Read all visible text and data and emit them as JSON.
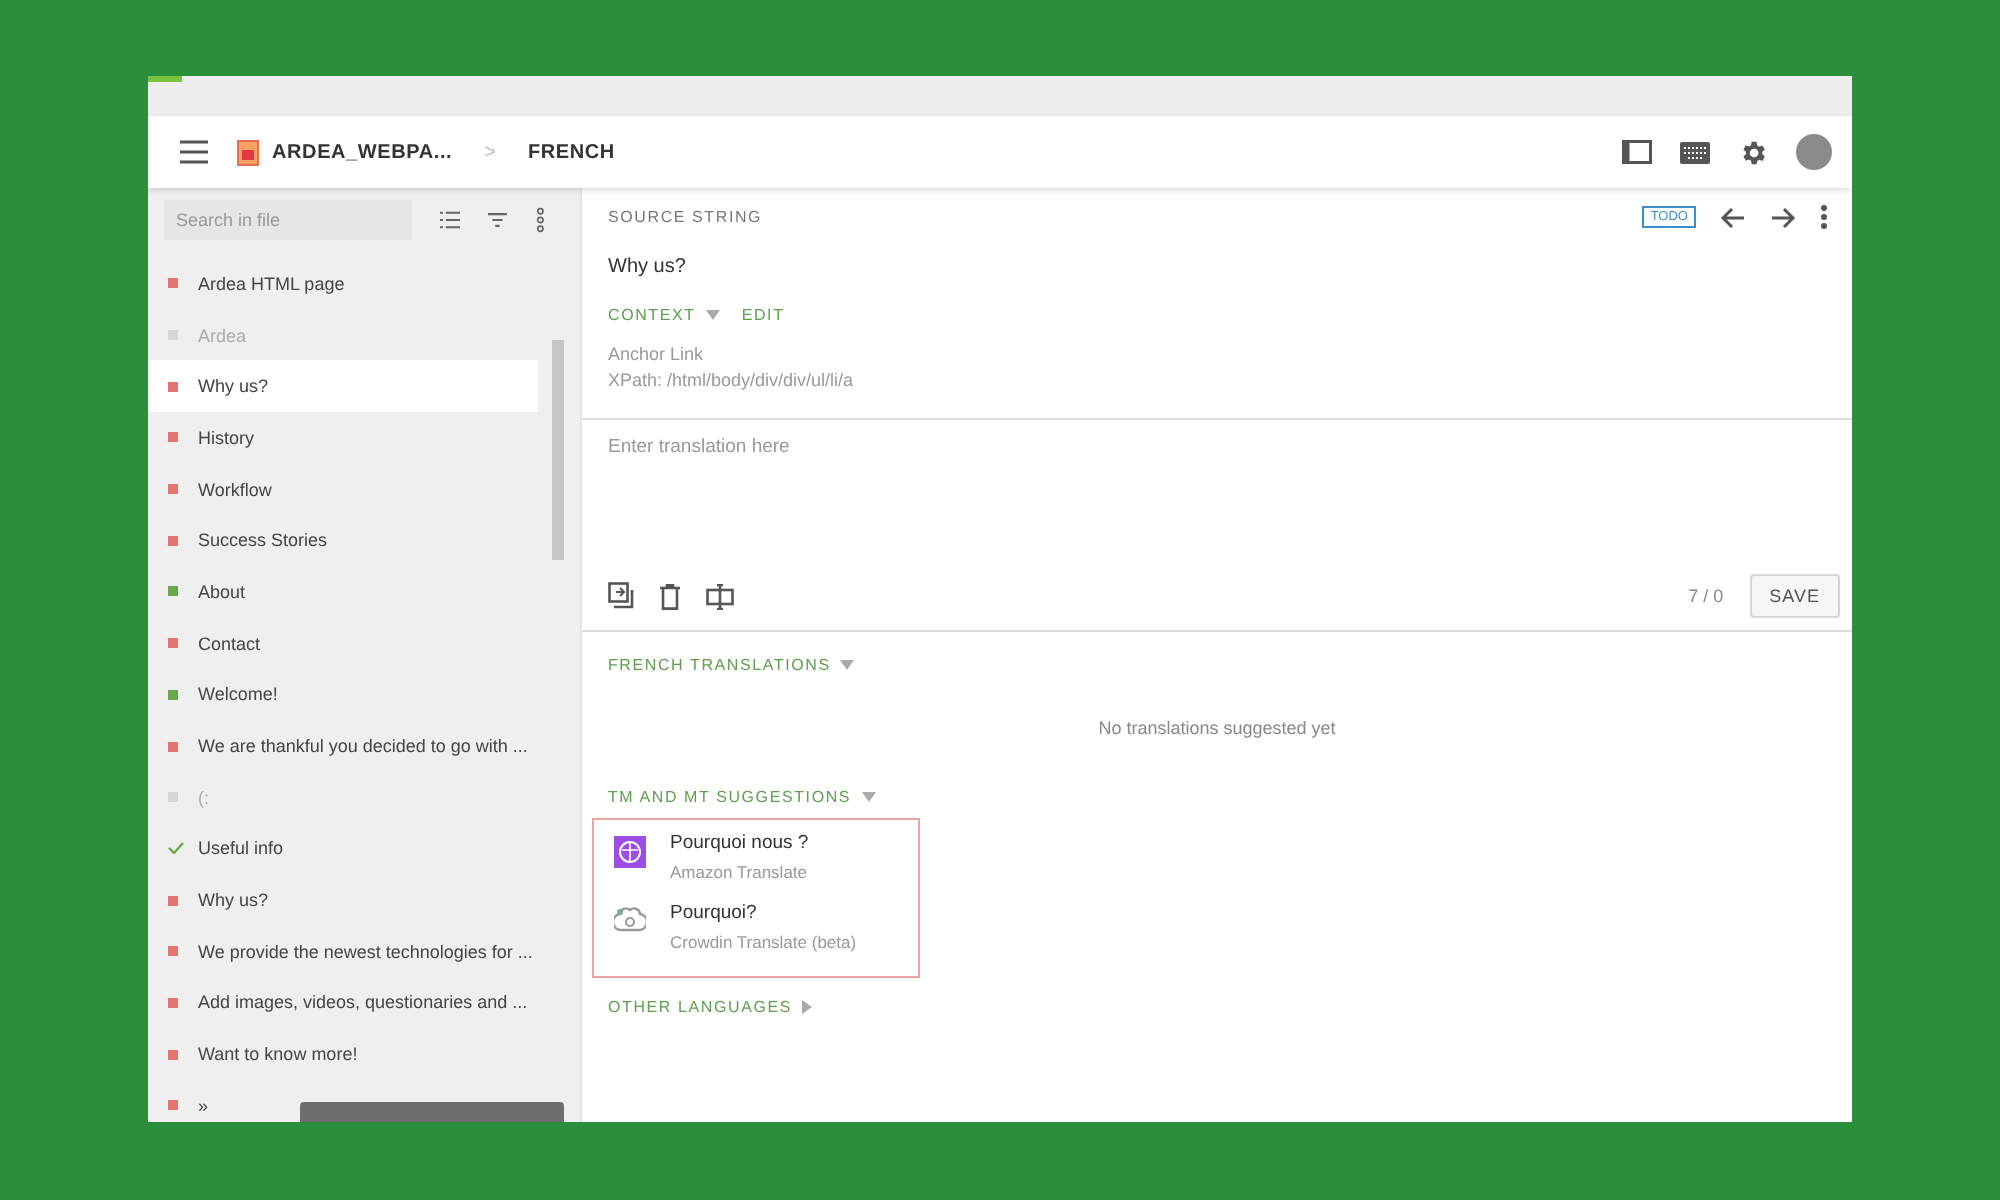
{
  "progress": {
    "level": 0.02
  },
  "header": {
    "file": "ARDEA_WEBPA...",
    "separator": ">",
    "language": "FRENCH"
  },
  "sidebar": {
    "search": {
      "placeholder": "Search in file"
    },
    "items": [
      {
        "label": "Ardea HTML page",
        "kind": "untranslated",
        "selected": false
      },
      {
        "label": "Ardea",
        "kind": "hidden",
        "selected": false
      },
      {
        "label": "Why us?",
        "kind": "untranslated",
        "selected": true
      },
      {
        "label": "History",
        "kind": "untranslated",
        "selected": false
      },
      {
        "label": "Workflow",
        "kind": "untranslated",
        "selected": false
      },
      {
        "label": "Success Stories",
        "kind": "untranslated",
        "selected": false
      },
      {
        "label": "About",
        "kind": "translated",
        "selected": false
      },
      {
        "label": "Contact",
        "kind": "untranslated",
        "selected": false
      },
      {
        "label": "Welcome!",
        "kind": "translated",
        "selected": false
      },
      {
        "label": "We are thankful you decided to go with ...",
        "kind": "untranslated",
        "selected": false
      },
      {
        "label": "(:",
        "kind": "hidden",
        "selected": false
      },
      {
        "label": "Useful info",
        "kind": "approved",
        "selected": false
      },
      {
        "label": "Why us?",
        "kind": "untranslated",
        "selected": false
      },
      {
        "label": "We provide the newest technologies for ...",
        "kind": "untranslated",
        "selected": false
      },
      {
        "label": "Add images, videos, questionaries and ...",
        "kind": "untranslated",
        "selected": false
      },
      {
        "label": "Want to know more!",
        "kind": "untranslated",
        "selected": false
      },
      {
        "label": "»",
        "kind": "untranslated",
        "selected": false
      }
    ]
  },
  "source": {
    "heading": "SOURCE STRING",
    "badge": "TODO",
    "text": "Why us?",
    "context_label": "CONTEXT",
    "edit_label": "EDIT",
    "context_lines": [
      "Anchor Link",
      "XPath: /html/body/div/div/ul/li/a"
    ]
  },
  "editor": {
    "placeholder": "Enter translation here",
    "counter": "7 / 0",
    "save": "SAVE"
  },
  "translations": {
    "heading": "FRENCH TRANSLATIONS",
    "empty": "No translations suggested yet"
  },
  "suggestions": {
    "heading": "TM AND MT SUGGESTIONS",
    "items": [
      {
        "text": "Pourquoi nous ?",
        "source": "Amazon Translate",
        "kind": "amazon"
      },
      {
        "text": "Pourquoi?",
        "source": "Crowdin Translate (beta)",
        "kind": "crowdin"
      }
    ]
  },
  "other": {
    "heading": "OTHER LANGUAGES"
  }
}
